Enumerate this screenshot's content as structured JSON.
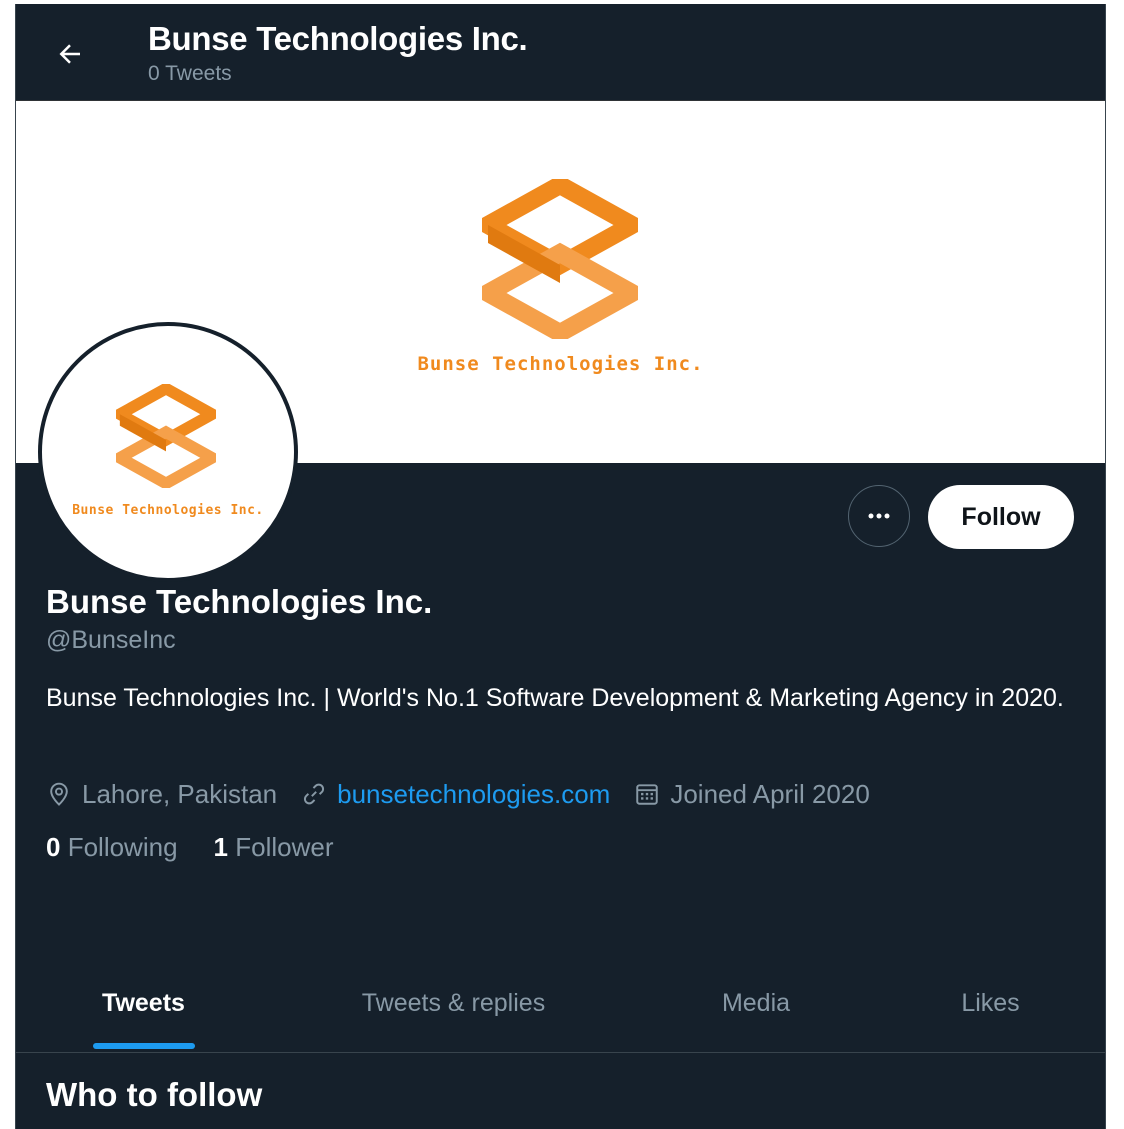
{
  "header": {
    "title": "Bunse Technologies Inc.",
    "tweet_count": "0 Tweets"
  },
  "banner": {
    "logo_text": "Bunse Technologies Inc."
  },
  "avatar": {
    "logo_text": "Bunse Technologies Inc."
  },
  "actions": {
    "more_label": "•••",
    "follow_label": "Follow"
  },
  "profile": {
    "name": "Bunse Technologies Inc.",
    "handle": "@BunseInc",
    "bio": "Bunse Technologies Inc. | World's No.1 Software Development & Marketing Agency in 2020.",
    "location": "Lahore, Pakistan",
    "website": "bunsetechnologies.com",
    "joined": "Joined April 2020",
    "following_count": "0",
    "following_label": "Following",
    "followers_count": "1",
    "followers_label": "Follower"
  },
  "tabs": [
    {
      "label": "Tweets",
      "active": true
    },
    {
      "label": "Tweets & replies",
      "active": false
    },
    {
      "label": "Media",
      "active": false
    },
    {
      "label": "Likes",
      "active": false
    }
  ],
  "who_to_follow": {
    "title": "Who to follow"
  },
  "colors": {
    "background": "#15202b",
    "accent": "#1d9bf0",
    "brand_orange": "#f08a1e",
    "muted_text": "#8899a6"
  },
  "icons": {
    "back": "arrow-left-icon",
    "location": "location-pin-icon",
    "link": "link-icon",
    "calendar": "calendar-icon",
    "more": "more-horizontal-icon"
  }
}
